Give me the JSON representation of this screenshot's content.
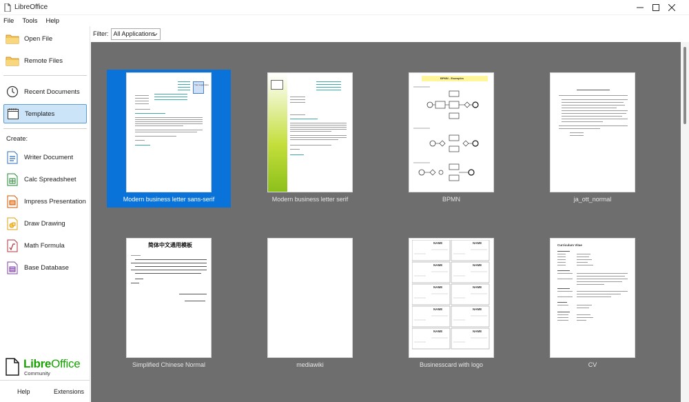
{
  "window": {
    "title": "LibreOffice"
  },
  "menu": {
    "file": "File",
    "tools": "Tools",
    "help": "Help"
  },
  "sidebar": {
    "open_file": "Open File",
    "remote_files": "Remote Files",
    "recent_documents": "Recent Documents",
    "templates": "Templates",
    "create_label": "Create:",
    "writer": "Writer Document",
    "calc": "Calc Spreadsheet",
    "impress": "Impress Presentation",
    "draw": "Draw Drawing",
    "math": "Math Formula",
    "base": "Base Database",
    "brand_main": "Libre",
    "brand_office": "Office",
    "brand_sub": "Community",
    "help": "Help",
    "extensions": "Extensions"
  },
  "filter": {
    "label": "Filter:",
    "selected": "All Applications"
  },
  "templates": [
    {
      "name": "Modern business letter sans-serif",
      "selected": true
    },
    {
      "name": "Modern business letter serif",
      "selected": false
    },
    {
      "name": "BPMN",
      "selected": false
    },
    {
      "name": "ja_ott_normal",
      "selected": false
    },
    {
      "name": "Simplified Chinese Normal",
      "selected": false
    },
    {
      "name": "mediawiki",
      "selected": false
    },
    {
      "name": "Businesscard with logo",
      "selected": false
    },
    {
      "name": "CV",
      "selected": false
    }
  ],
  "thumb_text": {
    "bpmn_title": "BPMN - Examples",
    "chinese_title": "简体中文通用模板",
    "cv_title": "Curriculum Vitae",
    "card_name": "NAME",
    "letter_box": "Your Logo Here"
  },
  "colors": {
    "selection": "#0a73d9",
    "area_bg": "#6e6e6e",
    "brand_green": "#18a303",
    "active_bg": "#cce4f7"
  }
}
